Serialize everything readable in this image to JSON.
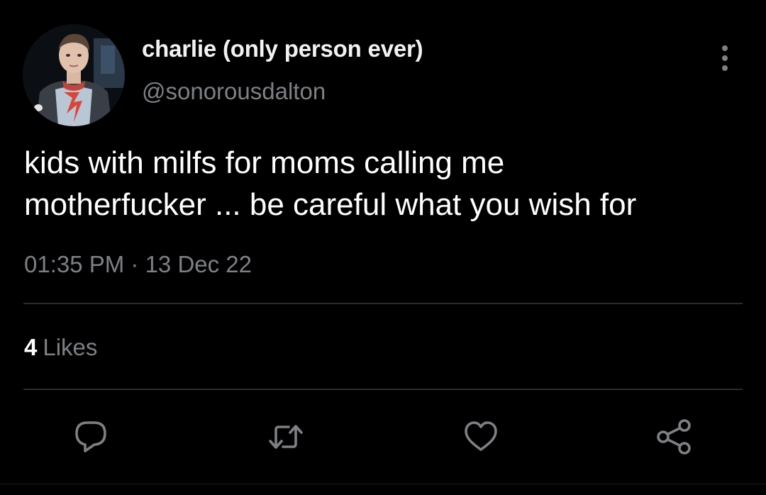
{
  "author": {
    "display_name": "charlie (only person ever)",
    "handle": "@sonorousdalton",
    "avatar_icon": "profile-photo"
  },
  "tweet": {
    "text_lines": [
      "kids with milfs for moms calling me",
      "motherfucker ... be careful what you wish for"
    ],
    "timestamp": "01:35 PM · 13 Dec 22"
  },
  "stats": {
    "likes_count": "4",
    "likes_label": "Likes"
  },
  "actions": {
    "reply_icon": "comment-icon",
    "retweet_icon": "retweet-icon",
    "like_icon": "heart-icon",
    "share_icon": "share-icon",
    "more_icon": "more-vertical-icon"
  },
  "colors": {
    "background": "#000000",
    "primary_text": "#ffffff",
    "secondary_text": "#7d8184",
    "divider": "#2a2d30",
    "icon": "#7d8184"
  }
}
